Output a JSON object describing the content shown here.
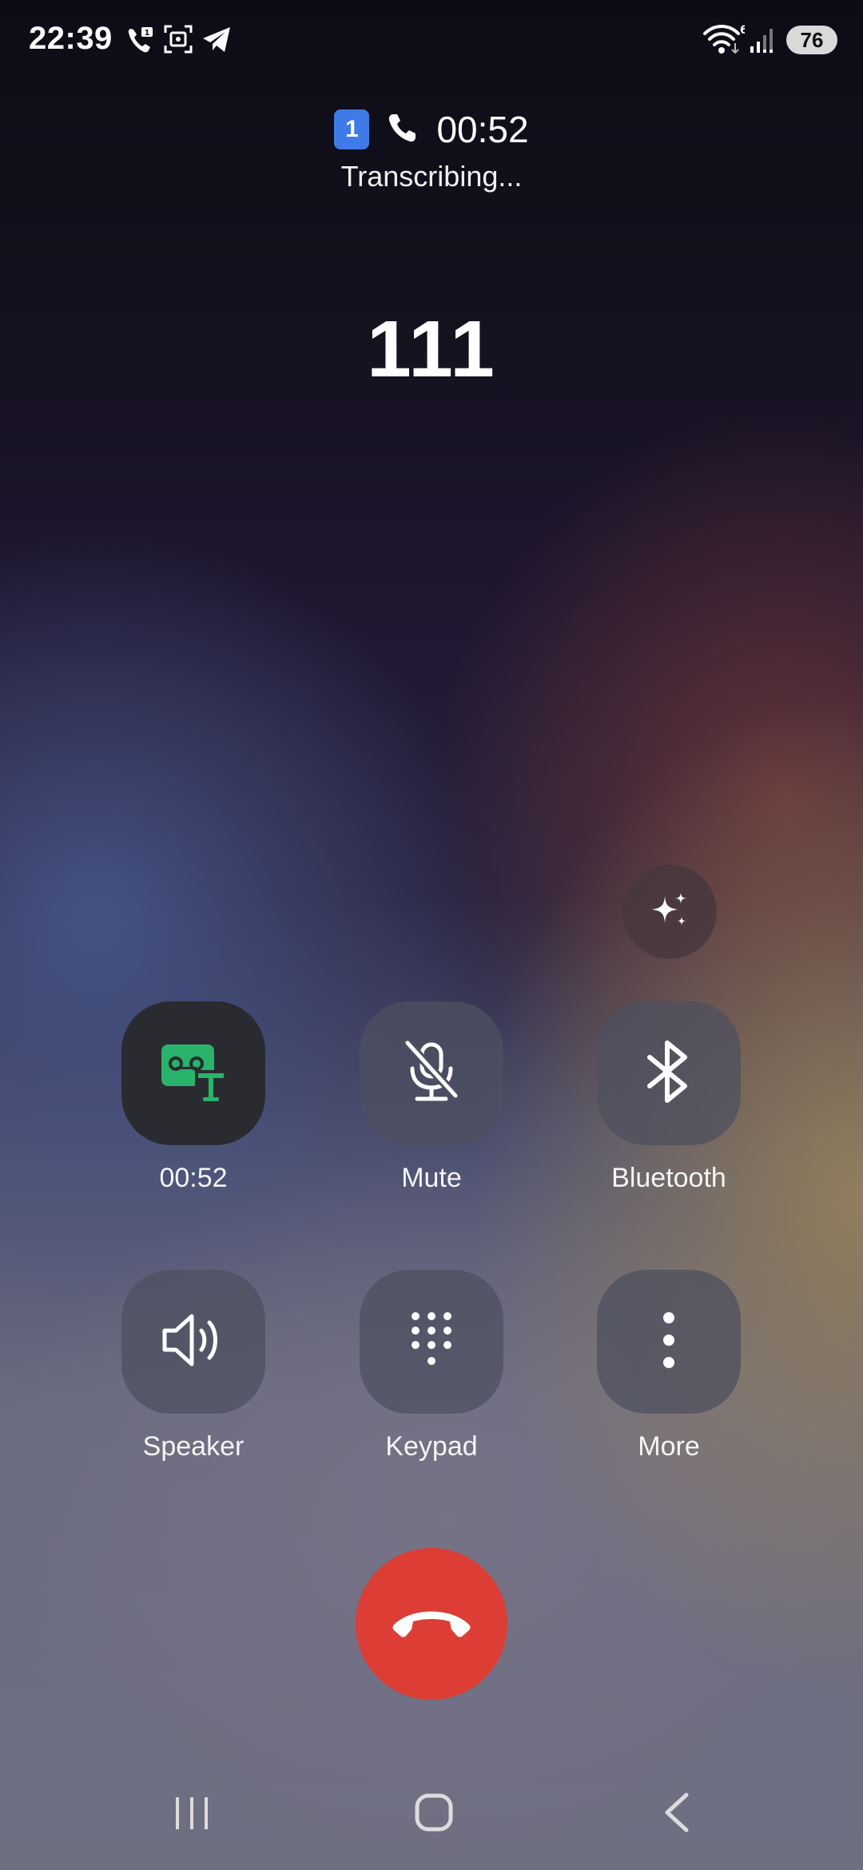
{
  "status_bar": {
    "time": "22:39",
    "battery": "76",
    "wifi_badge": "6",
    "icons": [
      "wifi-calling-icon",
      "screenshot-icon",
      "telegram-icon",
      "wifi-icon",
      "signal-icon",
      "battery-icon"
    ]
  },
  "call": {
    "sim_number": "1",
    "timer": "00:52",
    "status": "Transcribing...",
    "number": "111"
  },
  "controls": {
    "record": {
      "label": "00:52",
      "icon": "voicemail-transcribe-icon",
      "color": "#2ab36a"
    },
    "mute": {
      "label": "Mute",
      "icon": "mic-off-icon"
    },
    "bluetooth": {
      "label": "Bluetooth",
      "icon": "bluetooth-icon"
    },
    "speaker": {
      "label": "Speaker",
      "icon": "speaker-icon"
    },
    "keypad": {
      "label": "Keypad",
      "icon": "keypad-icon"
    },
    "more": {
      "label": "More",
      "icon": "more-vertical-icon"
    }
  },
  "end_call": {
    "icon": "end-call-icon",
    "color": "#dc3d35"
  },
  "ai_button": {
    "icon": "sparkle-icon"
  },
  "nav": {
    "items": [
      "recents-icon",
      "home-icon",
      "back-icon"
    ]
  }
}
